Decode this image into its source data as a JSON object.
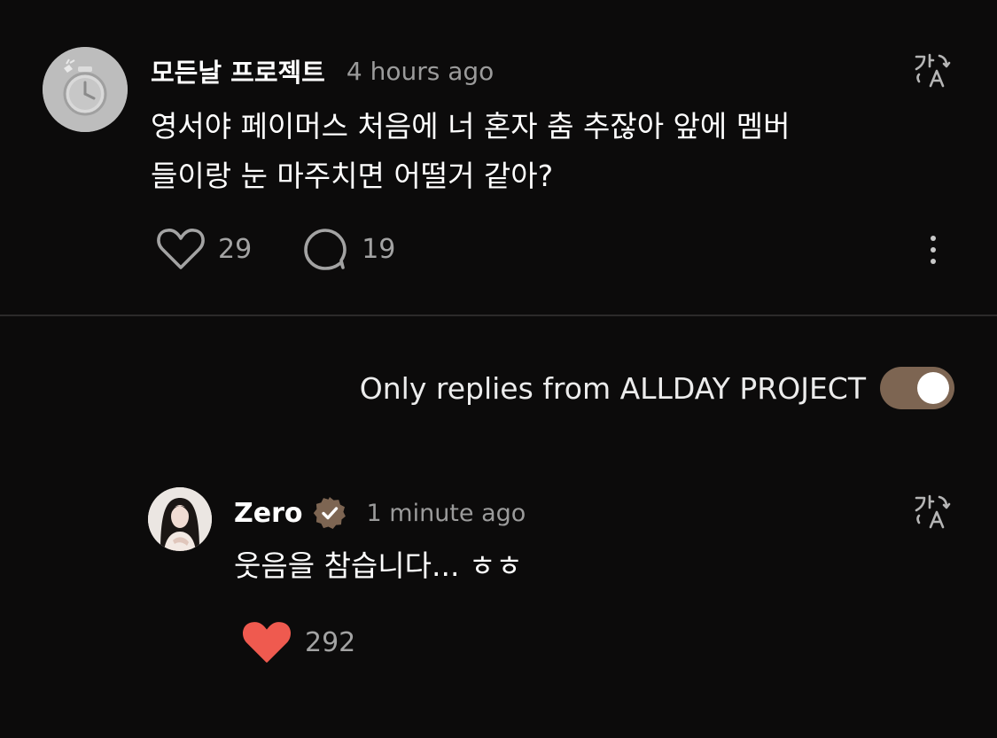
{
  "post": {
    "author": "모든날 프로젝트",
    "timestamp": "4 hours ago",
    "text_lines": [
      "영서야 페이머스 처음에 너 혼자 춤 추잖아 앞에 멤버",
      "들이랑 눈 마주치면 어떨거 같아?"
    ],
    "likes": "29",
    "replies": "19",
    "icons": {
      "avatar": "stopwatch-avatar-icon",
      "translate": "translate-icon",
      "like": "heart-outline-icon",
      "reply": "speech-bubble-icon",
      "more": "more-vertical-icon"
    }
  },
  "filter": {
    "label": "Only replies from ALLDAY PROJECT",
    "enabled": true
  },
  "reply": {
    "author": "Zero",
    "timestamp": "1 minute ago",
    "text": "웃음을 참습니다... ㅎㅎ",
    "likes": "292",
    "liked": true,
    "icons": {
      "avatar": "profile-photo-avatar",
      "verified": "verified-badge-icon",
      "translate": "translate-icon",
      "like": "heart-filled-icon"
    }
  },
  "colors": {
    "background": "#0c0b0b",
    "divider": "#2c2a2a",
    "secondary_text": "#9b9b9b",
    "action_icon": "#a3a3a3",
    "accent_brown": "#7d6552",
    "like_red": "#ef5a4f",
    "avatar_gray": "#bdbdbd"
  }
}
